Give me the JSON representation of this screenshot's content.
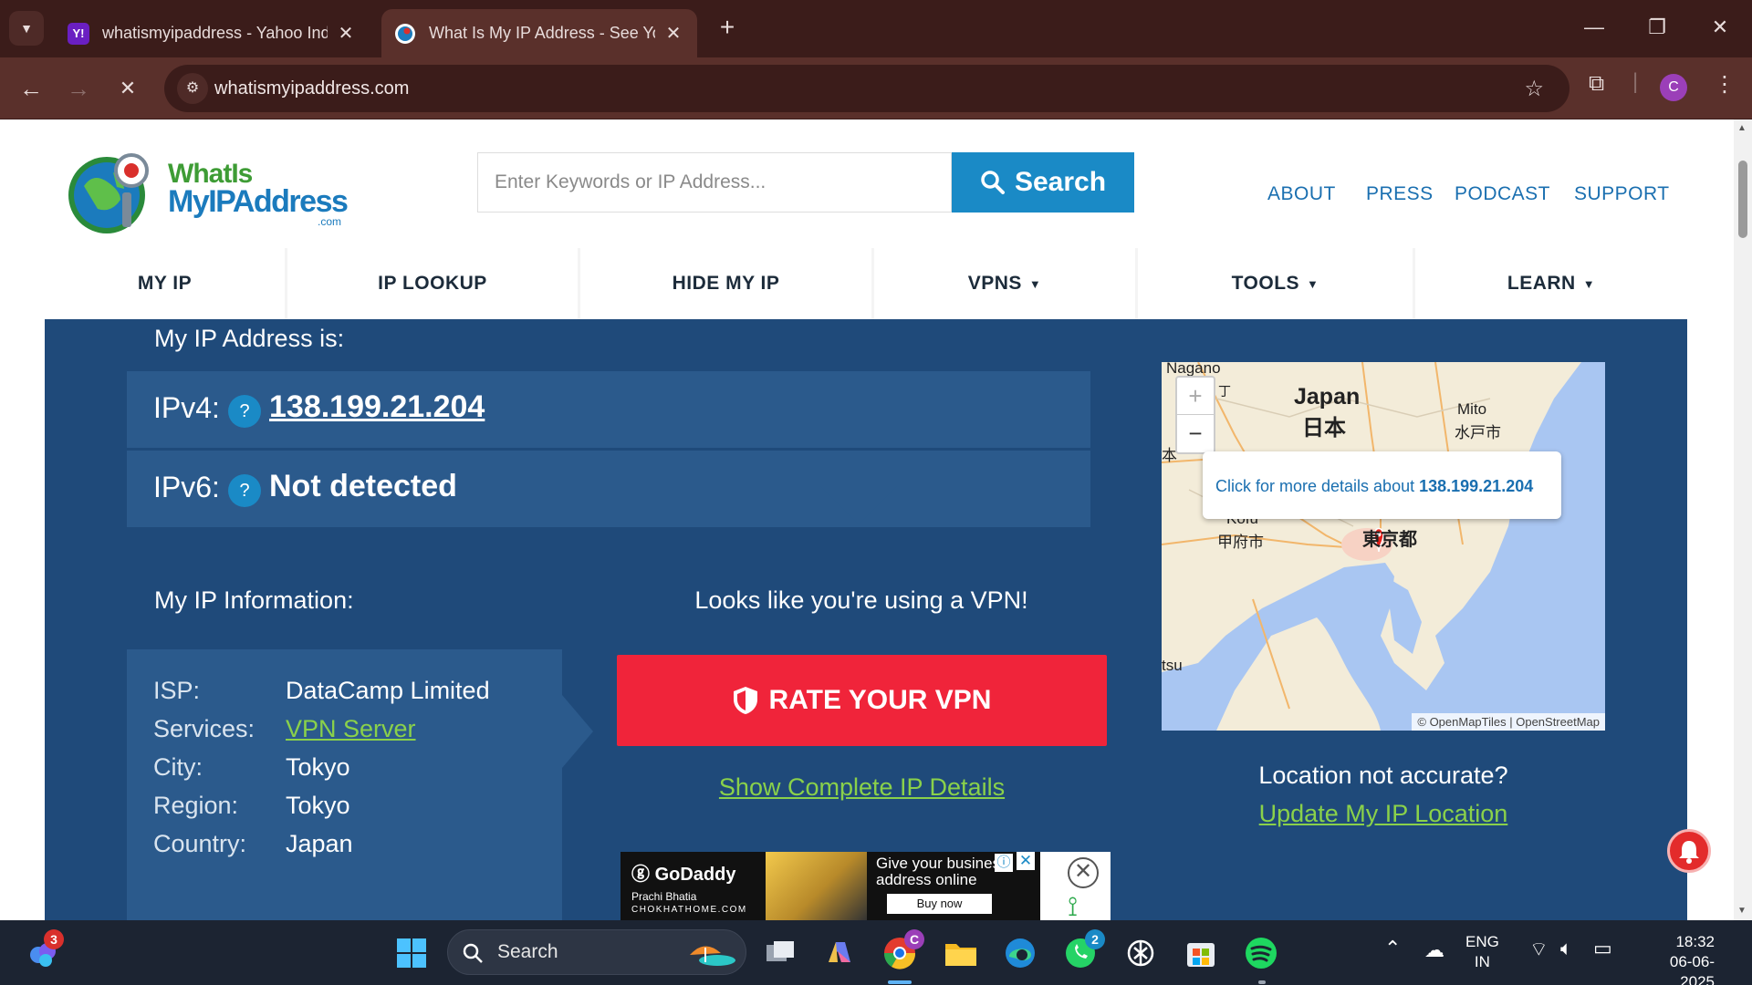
{
  "browser": {
    "tabs": [
      {
        "title": "whatismyipaddress - Yahoo Ind",
        "favicon": "Y!"
      },
      {
        "title": "What Is My IP Address - See Yo",
        "favicon": "globe"
      }
    ],
    "new_tab": "+",
    "url": "whatismyipaddress.com",
    "profile_initial": "C"
  },
  "site": {
    "logo": {
      "line1": "WhatIs",
      "line2": "MyIPAddress",
      "suffix": ".com"
    },
    "search": {
      "placeholder": "Enter Keywords or IP Address...",
      "button": "Search"
    },
    "top_links": [
      "ABOUT",
      "PRESS",
      "PODCAST",
      "SUPPORT"
    ],
    "nav": [
      {
        "label": "MY IP",
        "caret": ""
      },
      {
        "label": "IP LOOKUP",
        "caret": ""
      },
      {
        "label": "HIDE MY IP",
        "caret": ""
      },
      {
        "label": "VPNS",
        "caret": "▼"
      },
      {
        "label": "TOOLS",
        "caret": "▼"
      },
      {
        "label": "LEARN",
        "caret": "▼"
      }
    ],
    "heading": "My IP Address is:",
    "ipv4": {
      "label": "IPv4:",
      "value": "138.199.21.204",
      "help": "?"
    },
    "ipv6": {
      "label": "IPv6:",
      "value": "Not detected",
      "help": "?"
    },
    "info_heading": "My IP Information:",
    "info": [
      {
        "key": "ISP:",
        "value": "DataCamp Limited"
      },
      {
        "key": "Services:",
        "value": "VPN Server"
      },
      {
        "key": "City:",
        "value": "Tokyo"
      },
      {
        "key": "Region:",
        "value": "Tokyo"
      },
      {
        "key": "Country:",
        "value": "Japan"
      }
    ],
    "vpn_message": "Looks like you're using a VPN!",
    "rate_vpn": "RATE YOUR VPN",
    "show_details": "Show Complete IP Details",
    "map": {
      "popup_prefix": "Click for more details about",
      "popup_ip": "138.199.21.204",
      "attribution": "© OpenMapTiles | OpenStreetMap",
      "labels": {
        "nagano": "Nagano",
        "japan": "Japan",
        "japan_jp": "日本",
        "mito": "Mito",
        "mito_jp": "水戸市",
        "kofu": "Kofu",
        "kofu_jp": "甲府市",
        "tokyo_jp": "東京都",
        "tsu": "tsu",
        "edge_char": "本",
        "edge_char_top": "丁"
      },
      "zoom_in": "+",
      "zoom_out": "−"
    },
    "location_question": "Location not accurate?",
    "update_location": "Update My IP Location",
    "ad": {
      "brand": "GoDaddy",
      "person": "Prachi Bhatia",
      "site": "CHOKHATHOME.COM",
      "headline": "Give your business address online",
      "cta": "Buy now"
    }
  },
  "taskbar": {
    "search": "Search",
    "badges": {
      "copilot": "3",
      "chrome": "C",
      "whatsapp": "2"
    },
    "lang": "ENG",
    "region": "IN",
    "time": "18:32",
    "date": "06-06-2025"
  },
  "colors": {
    "chrome_dark": "#3b1c1a",
    "chrome_mid": "#5a302b",
    "site_blue": "#1f4a7a",
    "site_blue_light": "#2b5a8c",
    "accent_blue": "#1a8ac6",
    "link_green": "#8ad14a",
    "rate_red": "#f0243a"
  }
}
